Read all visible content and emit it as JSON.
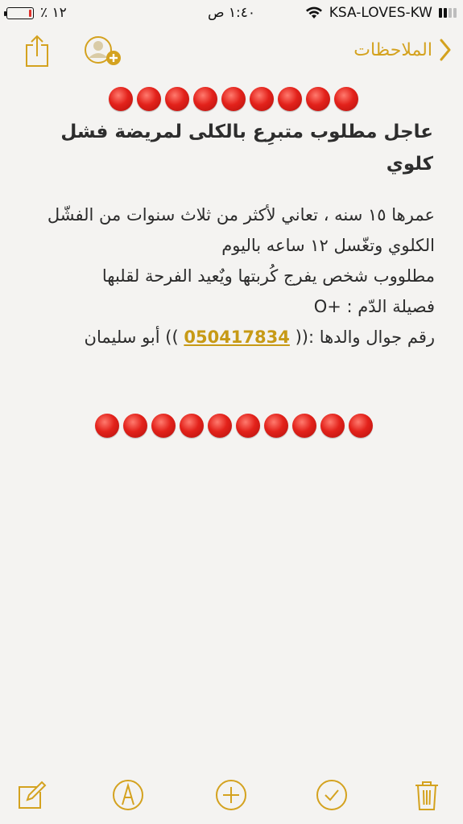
{
  "status": {
    "battery": "٪ ١٢",
    "battery_level": 0.12,
    "time": "١:٤٠ ص",
    "carrier": "KSA-LOVES-KW"
  },
  "nav": {
    "back_label": "الملاحظات"
  },
  "note": {
    "emoji_row_top_count": 9,
    "emoji_row_bottom_count": 10,
    "title": "عاجل مطلوب متبرِع بالكلى لمريضة فشل كلوي",
    "line1": "عمرها ١٥ سنه ، تعاني لأكثر من ثلاث سنوات من الفشّل الكلوي وتغّسل ١٢ ساعه باليوم",
    "line2": "مطلووب شخص يفرج كُربتها ويٌعيد الفرحة لقلبها",
    "line3": "فصيلة الدّم : +O",
    "phone_prefix": "رقم جوال والدها :((",
    "phone_number": "050417834",
    "phone_suffix": ")) أبو سليمان"
  },
  "colors": {
    "accent": "#d4a21f",
    "link": "#c79a16",
    "emoji_red": "#e3221b"
  },
  "toolbar": {
    "icons": [
      "compose-icon",
      "markup-icon",
      "add-icon",
      "checklist-icon",
      "trash-icon"
    ]
  }
}
